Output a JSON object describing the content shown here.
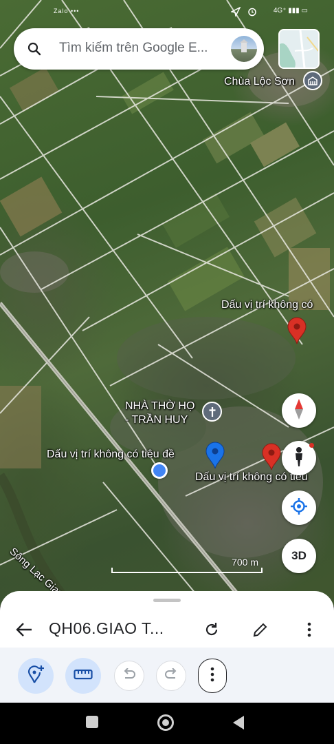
{
  "status_bar": {
    "left_text": "Zalo •••",
    "right_text": "4G⁺ ▮▮▮ ▭"
  },
  "search": {
    "placeholder": "Tìm kiếm trên Google E..."
  },
  "map": {
    "labels": {
      "chua_loc_son": "Chùa Lộc Sơn",
      "pin_top_right": "Dấu vị trí không có",
      "church": "NHÀ THỜ HỌ\n- TRẦN HUY",
      "church_line1": "NHÀ THỜ HỌ",
      "church_line2": "- TRẦN HUY",
      "pin_left": "Dấu vị trí không có tiêu đề",
      "pin_right": "Dấu vị trí không có tiêu",
      "river": "Sông Lạc Giang"
    },
    "scale_label": "700 m"
  },
  "buttons": {
    "three_d": "3D"
  },
  "sheet": {
    "title": "QH06.GIAO T..."
  },
  "colors": {
    "pin_red": "#d93025",
    "pin_blue": "#1a73e8",
    "tool_bg": "#d2e3fc",
    "tool_fg": "#174ea6"
  },
  "icons": [
    "search-icon",
    "map-thumbnail",
    "place-of-worship-icon",
    "compass-icon",
    "pegman-icon",
    "my-location-icon",
    "back-arrow-icon",
    "refresh-icon",
    "edit-icon",
    "more-vert-icon",
    "add-location-icon",
    "ruler-icon",
    "undo-icon",
    "redo-icon",
    "nav-square-icon",
    "nav-home-icon",
    "nav-back-icon"
  ]
}
